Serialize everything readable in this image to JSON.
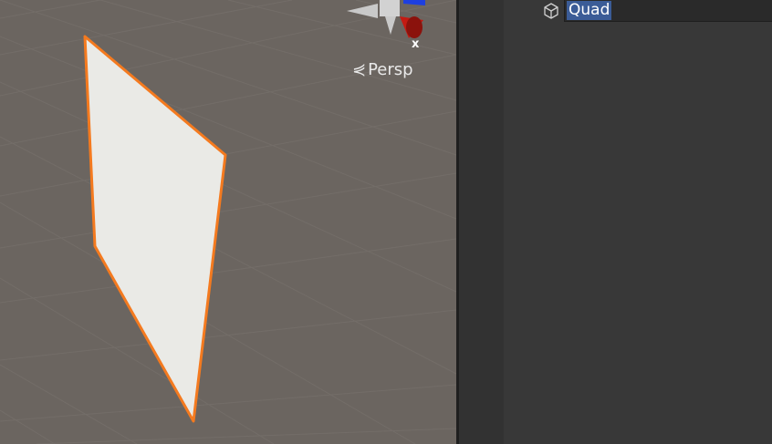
{
  "scene_view": {
    "projection_label": "Persp",
    "projection_icon": "perspective-icon",
    "gizmo": {
      "axis_label": "x"
    },
    "selected_object_colors": {
      "fill": "#eaeae6",
      "outline": "#f47a1f"
    },
    "grid_color": "#716b66",
    "background_color": "#6b6560"
  },
  "hierarchy": {
    "selected_item": {
      "icon": "cube-icon",
      "name": "Quad",
      "renaming": true
    }
  },
  "colors": {
    "panel_background": "#383838",
    "selection_highlight": "#3b5c97",
    "x_axis": "#c41a12",
    "z_axis": "#1d3fe0"
  }
}
